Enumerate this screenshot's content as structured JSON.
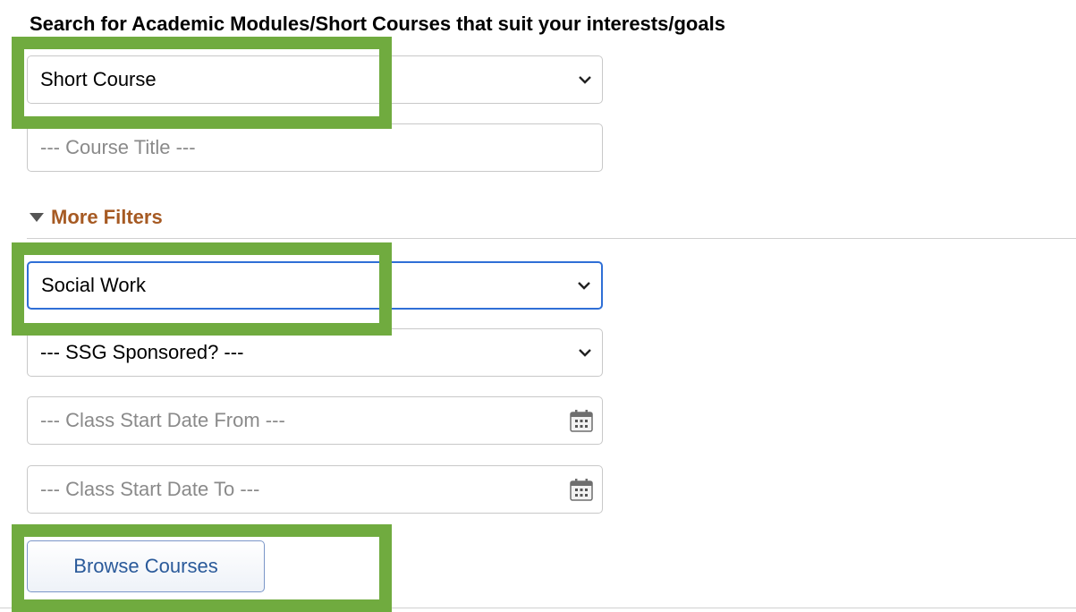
{
  "heading": "Search for Academic Modules/Short Courses that suit your interests/goals",
  "course_type_select": {
    "value": "Short Course"
  },
  "course_title_input": {
    "placeholder": "--- Course Title ---"
  },
  "more_filters": {
    "label": "More Filters"
  },
  "discipline_select": {
    "value": "Social Work"
  },
  "ssg_select": {
    "value": "--- SSG Sponsored? ---"
  },
  "start_from_input": {
    "placeholder": "--- Class Start Date From ---"
  },
  "start_to_input": {
    "placeholder": "--- Class Start Date To ---"
  },
  "browse_button": {
    "label": "Browse Courses"
  },
  "colors": {
    "highlight": "#70ab3f",
    "more_filters_text": "#a65a23",
    "focus_border": "#2f6fd6",
    "button_text": "#2a5a9a"
  },
  "icons": [
    "chevron-down-icon",
    "calendar-icon",
    "caret-down-icon"
  ]
}
